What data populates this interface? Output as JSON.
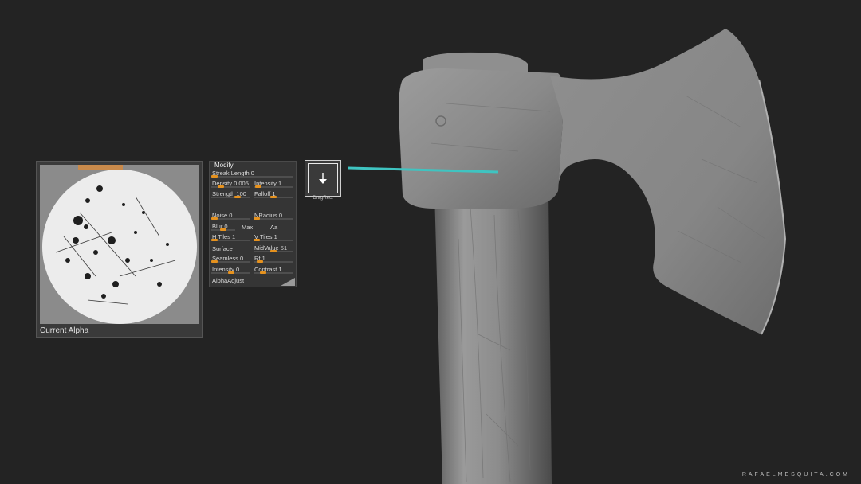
{
  "alpha_panel": {
    "caption": "Current Alpha"
  },
  "modify_panel": {
    "title": "Modify",
    "rows": {
      "streak_length": {
        "label": "Streak Length 0",
        "value": 0.0
      },
      "density": {
        "label": "Density 0.005",
        "value": 0.2
      },
      "intensity": {
        "label": "Intensity 1",
        "value": 0.05
      },
      "strength": {
        "label": "Strength 100",
        "value": 0.7
      },
      "falloff": {
        "label": "Falloff 1",
        "value": 0.5
      },
      "noise": {
        "label": "Noise 0",
        "value": 0.0
      },
      "nradius": {
        "label": "NRadius 0",
        "value": 0.0
      },
      "blur": {
        "label": "Blur 0",
        "value": 0.5
      },
      "max_label": "Max",
      "aa_label": "Aa",
      "h_tiles": {
        "label": "H Tiles 1",
        "value": 0.0
      },
      "v_tiles": {
        "label": "V Tiles 1",
        "value": 0.0
      },
      "surface_label": "Surface",
      "midvalue": {
        "label": "MidValue 51",
        "value": 0.5
      },
      "seamless": {
        "label": "Seamless 0",
        "value": 0.0
      },
      "rf": {
        "label": "Rf 1",
        "value": 0.1
      },
      "intensity2": {
        "label": "Intensity 0",
        "value": 0.5
      },
      "contrast": {
        "label": "Contrast 1",
        "value": 0.2
      },
      "alpha_adjust_label": "AlphaAdjust"
    }
  },
  "dragrect": {
    "label": "DragRect",
    "icon": "arrow-down-icon"
  },
  "watermark": "RAFAELMESQUITA.COM",
  "colors": {
    "background": "#232323",
    "slider_accent": "#e6921e",
    "callout_line": "#3fc4c1",
    "model_gray": "#8a8a8a"
  }
}
